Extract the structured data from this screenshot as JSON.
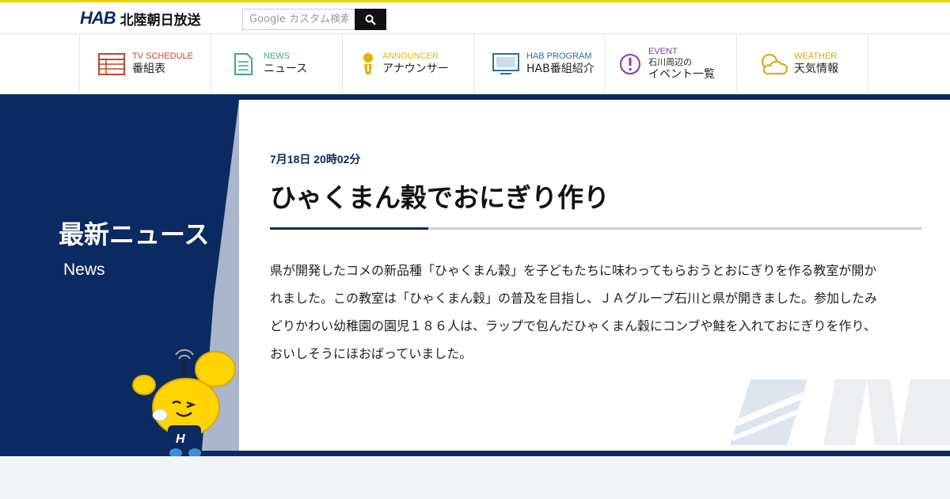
{
  "header": {
    "logo_mark": "HAB",
    "logo_text": "北陸朝日放送",
    "search_placeholder": "Google カスタム検索"
  },
  "nav": [
    {
      "en": "TV SCHEDULE",
      "jp": "番組表",
      "color": "#c0452b",
      "icon": "tv-schedule-icon"
    },
    {
      "en": "NEWS",
      "jp": "ニュース",
      "color": "#3aa88a",
      "icon": "news-icon"
    },
    {
      "en": "ANNOUNCER",
      "jp": "アナウンサー",
      "color": "#e6b400",
      "icon": "announcer-icon"
    },
    {
      "en": "HAB PROGRAM",
      "jp": "HAB番組紹介",
      "color": "#2b6ea8",
      "icon": "tv-icon"
    },
    {
      "en": "EVENT",
      "jp_small": "石川周辺の",
      "jp": "イベント一覧",
      "color": "#8a3aa0",
      "icon": "event-icon"
    },
    {
      "en": "WEATHER",
      "jp": "天気情報",
      "color": "#e6a100",
      "icon": "weather-icon"
    }
  ],
  "side": {
    "title": "最新ニュース",
    "subtitle": "News"
  },
  "article": {
    "date": "7月18日 20時02分",
    "title": "ひゃくまん穀でおにぎり作り",
    "body": "県が開発したコメの新品種「ひゃくまん穀」を子どもたちに味わってもらおうとおにぎりを作る教室が開かれました。この教室は「ひゃくまん穀」の普及を目指し、ＪＡグループ石川と県が開きました。参加したみどりかわい幼稚園の園児１８６人は、ラップで包んだひゃくまん穀にコンブや鮭を入れておにぎりを作り、おいしそうにほおばっていました。"
  },
  "colors": {
    "navy": "#0b2a62",
    "accent_yellow": "#f0d200"
  }
}
